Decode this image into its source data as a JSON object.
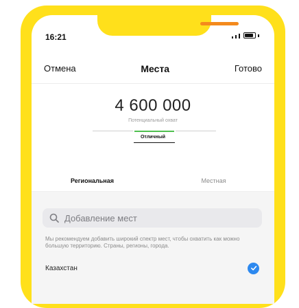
{
  "status_bar": {
    "time": "16:21"
  },
  "navbar": {
    "cancel_label": "Отмена",
    "title": "Места",
    "done_label": "Готово"
  },
  "reach": {
    "value": "4 600 000",
    "caption": "Потенциальный охват",
    "quality_label": "Отличный",
    "meter_segments_total": 3,
    "meter_active_segment": 2
  },
  "tabs": [
    {
      "label": "Региональная",
      "active": true
    },
    {
      "label": "Местная",
      "active": false
    }
  ],
  "search": {
    "placeholder": "Добавление мест"
  },
  "hint": "Мы рекомендуем добавить широкий спектр мест, чтобы охватить как можно большую территорию. Страны, регионы, города.",
  "locations": [
    {
      "name": "Казахстан",
      "selected": true
    }
  ],
  "colors": {
    "frame": "#ffe01b",
    "speaker": "#f48a1d",
    "meter_active": "#4fbf4f",
    "check": "#2d89ef"
  }
}
